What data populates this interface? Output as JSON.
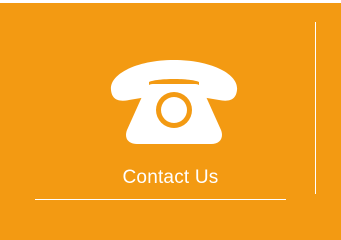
{
  "contact_tile": {
    "label": "Contact Us",
    "icon": "phone-icon",
    "background_color": "#f39a12",
    "foreground_color": "#ffffff"
  }
}
